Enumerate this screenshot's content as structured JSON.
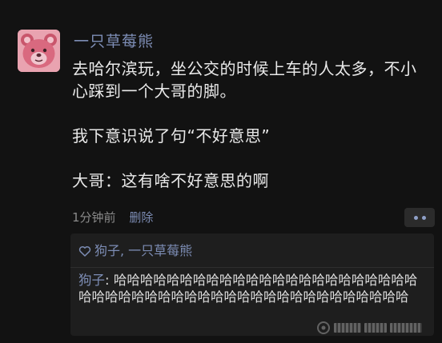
{
  "post": {
    "author": "一只草莓熊",
    "paragraphs": [
      "去哈尔滨玩，坐公交的时候上车的人太多，不小心踩到一个大哥的脚。",
      "我下意识说了句“不好意思”",
      "大哥：这有啥不好意思的啊"
    ],
    "time": "1分钟前",
    "delete_label": "删除"
  },
  "likes": {
    "names": "狗子, 一只草莓熊"
  },
  "comment": {
    "author": "狗子",
    "separator": ": ",
    "text": "哈哈哈哈哈哈哈哈哈哈哈哈哈哈哈哈哈哈哈哈哈哈哈哈哈哈哈哈哈哈哈哈哈哈哈哈哈哈哈哈哈哈哈哈哈哈哈哈"
  },
  "colors": {
    "background": "#121212",
    "link": "#7d8db5",
    "text": "#e9e9e9",
    "muted": "#8a8a8a",
    "panel": "#1e1e1e"
  },
  "icons": {
    "avatar": "strawberry-bear-avatar",
    "like": "heart-outline-icon",
    "more": "more-dots-icon"
  }
}
